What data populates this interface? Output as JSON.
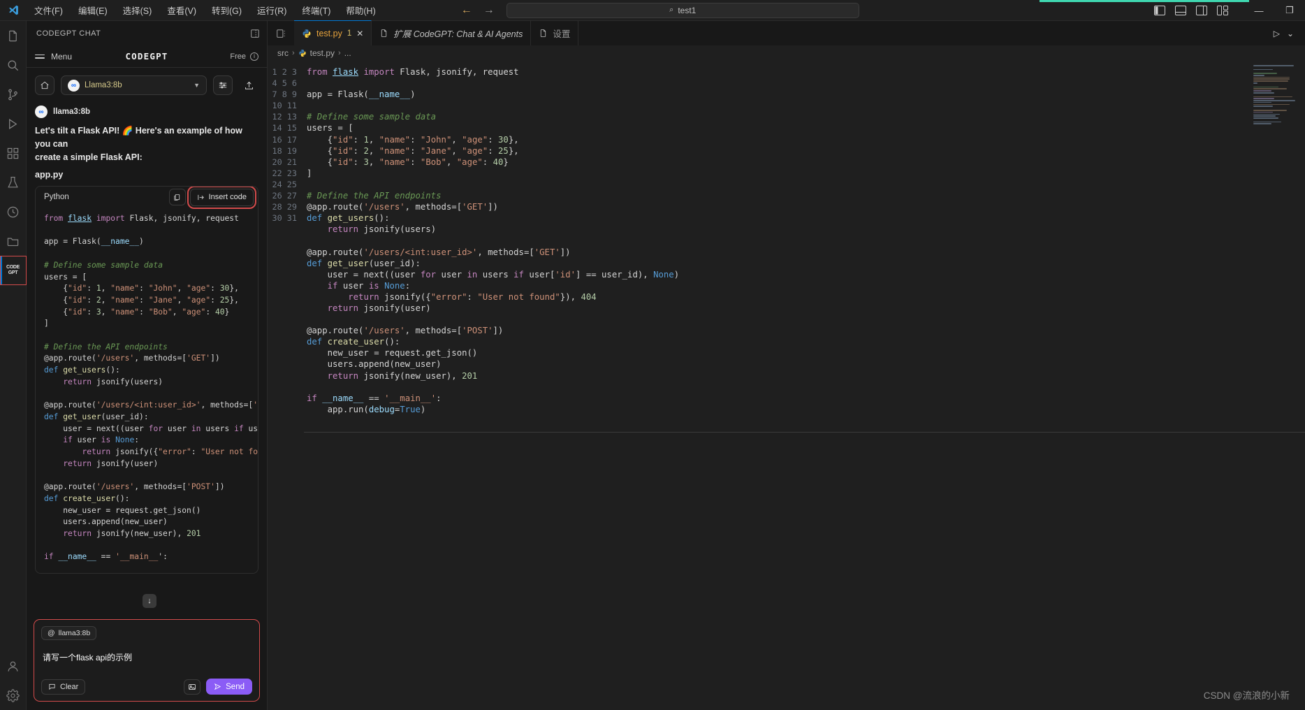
{
  "titlebar": {
    "menus": [
      "文件(F)",
      "编辑(E)",
      "选择(S)",
      "查看(V)",
      "转到(G)",
      "运行(R)",
      "终端(T)",
      "帮助(H)"
    ],
    "back_icon": "arrow-left-icon",
    "forward_icon": "arrow-right-icon",
    "search_icon": "search-icon",
    "search_value": "test1",
    "layout_icons": [
      "toggle-primary-sidebar-icon",
      "toggle-panel-icon",
      "toggle-secondary-sidebar-icon",
      "customize-layout-icon"
    ],
    "minimize": "—",
    "restore": "❐",
    "accent": "#3fd7b0"
  },
  "activitybar": {
    "items": [
      {
        "name": "explorer-icon",
        "glyph": "files"
      },
      {
        "name": "search-icon",
        "glyph": "search"
      },
      {
        "name": "source-control-icon",
        "glyph": "branch"
      },
      {
        "name": "run-and-debug-icon",
        "glyph": "debug"
      },
      {
        "name": "extensions-icon",
        "glyph": "extensions"
      },
      {
        "name": "testing-icon",
        "glyph": "beaker"
      },
      {
        "name": "timeline-icon",
        "glyph": "clock"
      },
      {
        "name": "remote-explorer-icon",
        "glyph": "folder"
      },
      {
        "name": "codegpt-icon",
        "glyph": "codegpt",
        "label": "CODE GPT",
        "active": true
      }
    ],
    "bottom": [
      {
        "name": "accounts-icon",
        "glyph": "person"
      },
      {
        "name": "settings-gear-icon",
        "glyph": "gear"
      }
    ]
  },
  "sidebar": {
    "title": "CODEGPT CHAT",
    "header_icon": "split-editor-icon",
    "topbar": {
      "menu_label": "Menu",
      "brand": "CODEGPT",
      "plan_label": "Free",
      "plan_icon": "info-circle-icon"
    },
    "controls": {
      "home_icon": "home-icon",
      "model_avatar": "meta-logo-icon",
      "model_name": "Llama3:8b",
      "chevron": "chevron-down-icon",
      "settings_icon": "sliders-icon",
      "upload_icon": "upload-icon"
    },
    "message": {
      "avatar": "meta-logo-icon",
      "author": "llama3:8b",
      "line1": "Let's tilt a Flask API! 🌈 Here's an example of how you can",
      "line2": "create a simple Flask API:",
      "filename": "app.py"
    },
    "codeblock": {
      "language": "Python",
      "copy_icon": "copy-icon",
      "insert_icon": "insert-code-icon",
      "insert_label": "Insert code",
      "highlight_color": "#d24b4b"
    },
    "scroll_down_icon": "chevron-down-icon",
    "composer": {
      "chip_icon": "at-icon",
      "chip_label": "llama3:8b",
      "prompt": "请写一个flask api的示例",
      "clear_icon": "comment-icon",
      "clear_label": "Clear",
      "image_icon": "image-icon",
      "send_icon": "send-icon",
      "send_label": "Send",
      "send_color": "#8b5cf6",
      "border_color": "#d24b4b"
    }
  },
  "editor": {
    "tabs": [
      {
        "icon": "python-file-icon",
        "label": "test.py",
        "dirty": "1",
        "close": "✕",
        "active": true,
        "italic": false
      },
      {
        "icon": "generic-file-icon",
        "label": "扩展 CodeGPT: Chat & AI Agents",
        "active": false,
        "italic": true
      },
      {
        "icon": "generic-file-icon",
        "label": "设置",
        "active": false,
        "italic": false
      }
    ],
    "tabbar_left_icon": "open-editors-icon",
    "tabbar_right": [
      {
        "name": "run-python-icon",
        "glyph": "▷"
      },
      {
        "name": "more-actions-icon",
        "glyph": "⌄"
      }
    ],
    "breadcrumb": [
      "src",
      "test.py",
      "..."
    ],
    "breadcrumb_icon": "python-file-icon",
    "line_numbers": [
      1,
      2,
      3,
      4,
      5,
      6,
      7,
      8,
      9,
      10,
      11,
      12,
      13,
      14,
      15,
      16,
      17,
      18,
      19,
      20,
      21,
      22,
      23,
      24,
      25,
      26,
      27,
      28,
      29,
      30,
      31
    ],
    "code_lines": [
      "from flask import Flask, jsonify, request",
      "",
      "app = Flask(__name__)",
      "",
      "# Define some sample data",
      "users = [",
      "    {\"id\": 1, \"name\": \"John\", \"age\": 30},",
      "    {\"id\": 2, \"name\": \"Jane\", \"age\": 25},",
      "    {\"id\": 3, \"name\": \"Bob\", \"age\": 40}",
      "]",
      "",
      "# Define the API endpoints",
      "@app.route('/users', methods=['GET'])",
      "def get_users():",
      "    return jsonify(users)",
      "",
      "@app.route('/users/<int:user_id>', methods=['GET'])",
      "def get_user(user_id):",
      "    user = next((user for user in users if user['id'] == user_id), None)",
      "    if user is None:",
      "        return jsonify({\"error\": \"User not found\"}), 404",
      "    return jsonify(user)",
      "",
      "@app.route('/users', methods=['POST'])",
      "def create_user():",
      "    new_user = request.get_json()",
      "    users.append(new_user)",
      "    return jsonify(new_user), 201",
      "",
      "if __name__ == '__main__':",
      "    app.run(debug=True)"
    ],
    "watermark": "CSDN @流浪的小新"
  }
}
